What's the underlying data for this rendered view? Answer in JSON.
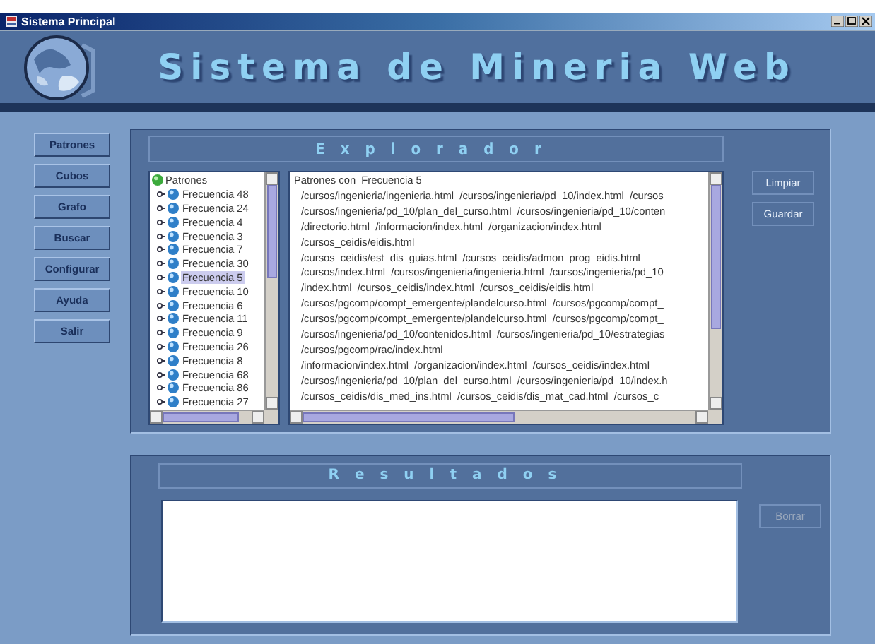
{
  "window": {
    "title": "Sistema Principal"
  },
  "header": {
    "title": "Sistema de Mineria Web"
  },
  "menu": [
    {
      "label": "Patrones"
    },
    {
      "label": "Cubos"
    },
    {
      "label": "Grafo"
    },
    {
      "label": "Buscar"
    },
    {
      "label": "Configurar"
    },
    {
      "label": "Ayuda"
    },
    {
      "label": "Salir"
    }
  ],
  "explorer": {
    "title": "Explorador",
    "tree": {
      "label": "Patrones",
      "children": [
        {
          "label": "Frecuencia 48",
          "selected": false
        },
        {
          "label": "Frecuencia 24",
          "selected": false
        },
        {
          "label": "Frecuencia 4",
          "selected": false
        },
        {
          "label": "Frecuencia 3",
          "selected": false
        },
        {
          "label": "Frecuencia 7",
          "selected": false
        },
        {
          "label": "Frecuencia 30",
          "selected": false
        },
        {
          "label": "Frecuencia 5",
          "selected": true
        },
        {
          "label": "Frecuencia 10",
          "selected": false
        },
        {
          "label": "Frecuencia 6",
          "selected": false
        },
        {
          "label": "Frecuencia 11",
          "selected": false
        },
        {
          "label": "Frecuencia 9",
          "selected": false
        },
        {
          "label": "Frecuencia 26",
          "selected": false
        },
        {
          "label": "Frecuencia 8",
          "selected": false
        },
        {
          "label": "Frecuencia 68",
          "selected": false
        },
        {
          "label": "Frecuencia 86",
          "selected": false
        },
        {
          "label": "Frecuencia 27",
          "selected": false
        }
      ]
    },
    "text_lines": [
      "Patrones con  Frecuencia 5",
      "/cursos/ingenieria/ingenieria.html  /cursos/ingenieria/pd_10/index.html  /cursos",
      "/cursos/ingenieria/pd_10/plan_del_curso.html  /cursos/ingenieria/pd_10/conten",
      "/directorio.html  /informacion/index.html  /organizacion/index.html",
      "/cursos_ceidis/eidis.html",
      "/cursos_ceidis/est_dis_guias.html  /cursos_ceidis/admon_prog_eidis.html",
      "/cursos/index.html  /cursos/ingenieria/ingenieria.html  /cursos/ingenieria/pd_10",
      "/index.html  /cursos_ceidis/index.html  /cursos_ceidis/eidis.html",
      "/cursos/pgcomp/compt_emergente/plandelcurso.html  /cursos/pgcomp/compt_",
      "/cursos/pgcomp/compt_emergente/plandelcurso.html  /cursos/pgcomp/compt_",
      "/cursos/ingenieria/pd_10/contenidos.html  /cursos/ingenieria/pd_10/estrategias",
      "/cursos/pgcomp/rac/index.html",
      "/informacion/index.html  /organizacion/index.html  /cursos_ceidis/index.html",
      "/cursos/ingenieria/pd_10/plan_del_curso.html  /cursos/ingenieria/pd_10/index.h",
      "/cursos_ceidis/dis_med_ins.html  /cursos_ceidis/dis_mat_cad.html  /cursos_c"
    ],
    "buttons": [
      {
        "label": "Limpiar",
        "disabled": false
      },
      {
        "label": "Guardar",
        "disabled": false
      }
    ]
  },
  "results": {
    "title": "Resultados",
    "buttons": [
      {
        "label": "Borrar",
        "disabled": true
      }
    ]
  }
}
